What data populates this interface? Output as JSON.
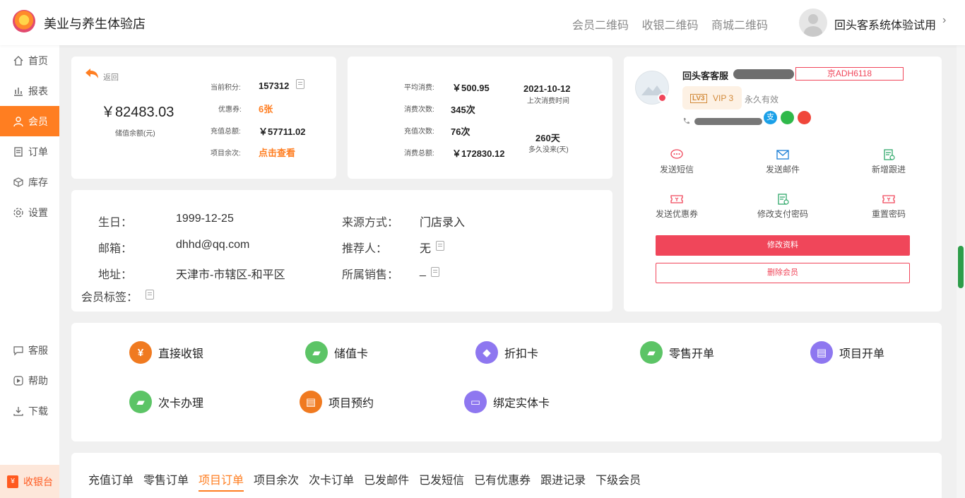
{
  "header": {
    "store_name": "美业与养生体验店",
    "links": [
      "会员二维码",
      "收银二维码",
      "商城二维码"
    ],
    "user_name": "回头客系统体验试用",
    "chevron": "›"
  },
  "sidebar": {
    "items": [
      {
        "label": "首页",
        "icon": "home-icon"
      },
      {
        "label": "报表",
        "icon": "chart-icon"
      },
      {
        "label": "会员",
        "icon": "user-icon"
      },
      {
        "label": "订单",
        "icon": "order-icon"
      },
      {
        "label": "库存",
        "icon": "box-icon"
      },
      {
        "label": "设置",
        "icon": "gear-icon"
      }
    ],
    "bottom_items": [
      {
        "label": "客服",
        "icon": "chat-icon"
      },
      {
        "label": "帮助",
        "icon": "help-icon"
      },
      {
        "label": "下载",
        "icon": "download-icon"
      }
    ],
    "cashier": {
      "label": "收银台",
      "icon_glyph": "¥"
    }
  },
  "balance_card": {
    "back_label": "返回",
    "balance": "￥82483.03",
    "balance_caption": "储值余额(元)",
    "points_label": "当前积分:",
    "points_value": "157312",
    "coupon_label": "优惠券:",
    "coupon_value": "6张",
    "recharge_total_label": "充值总额:",
    "recharge_total_value": "￥57711.02",
    "project_remaining_label": "项目余次:",
    "project_remaining_value": "点击查看"
  },
  "consume_card": {
    "avg_label": "平均消费:",
    "avg_value": "￥500.95",
    "count_label": "消费次数:",
    "count_value": "345次",
    "recharge_count_label": "充值次数:",
    "recharge_count_value": "76次",
    "total_label": "消费总额:",
    "total_value": "￥172830.12",
    "last_date": "2021-10-12",
    "last_date_caption": "上次消费时间",
    "days": "260天",
    "days_caption": "多久没来(天)"
  },
  "info_card": {
    "birthday_label": "生日：",
    "birthday_value": "1999-12-25",
    "source_label": "来源方式：",
    "source_value": "门店录入",
    "email_label": "邮箱：",
    "email_value": "dhhd@qq.com",
    "referrer_label": "推荐人：",
    "referrer_value": "无",
    "address_label": "地址：",
    "address_value": "天津市-市辖区-和平区",
    "sales_label": "所属销售：",
    "sales_value": "_",
    "tags_label": "会员标签："
  },
  "member_panel": {
    "name": "回头客客服",
    "plate": "京ADH6118",
    "vip_badge": "LV3",
    "vip_label": "VIP 3",
    "validity": "永久有效",
    "actions": [
      {
        "label": "发送短信",
        "icon": "sms-icon"
      },
      {
        "label": "发送邮件",
        "icon": "mail-icon"
      },
      {
        "label": "新增跟进",
        "icon": "followup-icon"
      },
      {
        "label": "发送优惠券",
        "icon": "coupon-icon"
      },
      {
        "label": "修改支付密码",
        "icon": "paypass-icon"
      },
      {
        "label": "重置密码",
        "icon": "reset-icon"
      }
    ],
    "edit_button": "修改资料",
    "delete_button": "删除会员"
  },
  "quick_actions": [
    {
      "label": "直接收银",
      "icon": "cashier-icon",
      "color": "#f07a20"
    },
    {
      "label": "储值卡",
      "icon": "stored-card-icon",
      "color": "#5cc466"
    },
    {
      "label": "折扣卡",
      "icon": "discount-card-icon",
      "color": "#8e77f0"
    },
    {
      "label": "零售开单",
      "icon": "retail-icon",
      "color": "#5cc466"
    },
    {
      "label": "项目开单",
      "icon": "project-order-icon",
      "color": "#8e77f0"
    },
    {
      "label": "次卡办理",
      "icon": "count-card-icon",
      "color": "#5cc466"
    },
    {
      "label": "项目预约",
      "icon": "booking-icon",
      "color": "#f07a20"
    },
    {
      "label": "绑定实体卡",
      "icon": "bind-card-icon",
      "color": "#8e77f0"
    }
  ],
  "tabs": [
    "充值订单",
    "零售订单",
    "项目订单",
    "项目余次",
    "次卡订单",
    "已发邮件",
    "已发短信",
    "已有优惠券",
    "跟进记录",
    "下级会员"
  ],
  "colors": {
    "accent": "#ff7e21",
    "danger": "#f0465a",
    "green": "#5cc466",
    "purple": "#8e77f0"
  }
}
